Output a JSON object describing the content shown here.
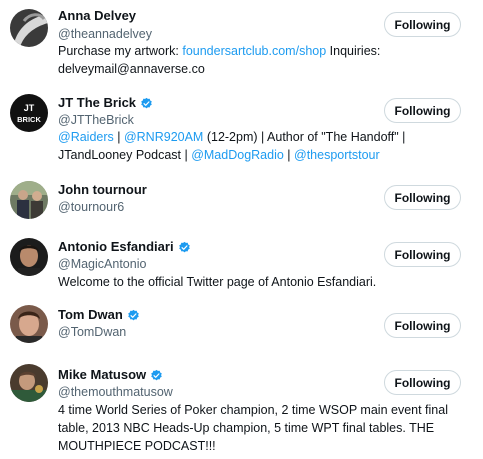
{
  "accounts": [
    {
      "name": "Anna Delvey",
      "handle": "@theannadelvey",
      "verified": false,
      "button_label": "Following",
      "bio_parts": {
        "text1": "Purchase my artwork: ",
        "link1": "foundersartclub.com/shop",
        "text2": " Inquiries: delveymail@annaverse.co"
      }
    },
    {
      "name": "JT The Brick",
      "handle": "@JTTheBrick",
      "verified": true,
      "button_label": "Following",
      "avatar_text": "BRICK",
      "avatar_initials": "JT",
      "bio_parts": {
        "link1": "@Raiders",
        "text1": " | ",
        "link2": "@RNR920AM",
        "text2": " (12-2pm) | Author of \"The Handoff\" | JTandLooney Podcast | ",
        "link3": "@MadDogRadio",
        "text3": " | ",
        "link4": "@thesportstour"
      }
    },
    {
      "name": "John tournour",
      "handle": "@tournour6",
      "verified": false,
      "button_label": "Following"
    },
    {
      "name": "Antonio Esfandiari",
      "handle": "@MagicAntonio",
      "verified": true,
      "button_label": "Following",
      "bio": "Welcome to the official Twitter page of Antonio Esfandiari."
    },
    {
      "name": "Tom Dwan",
      "handle": "@TomDwan",
      "verified": true,
      "button_label": "Following"
    },
    {
      "name": "Mike Matusow",
      "handle": "@themouthmatusow",
      "verified": true,
      "button_label": "Following",
      "bio": "4 time World Series of Poker champion, 2 time WSOP main event final table, 2013 NBC Heads-Up champion, 5 time WPT final tables. THE MOUTHPIECE PODCAST!!!"
    }
  ],
  "colors": {
    "link": "#1d9bf0",
    "verified": "#1d9bf0",
    "secondary_text": "#536471",
    "button_border": "#cfd9de"
  }
}
